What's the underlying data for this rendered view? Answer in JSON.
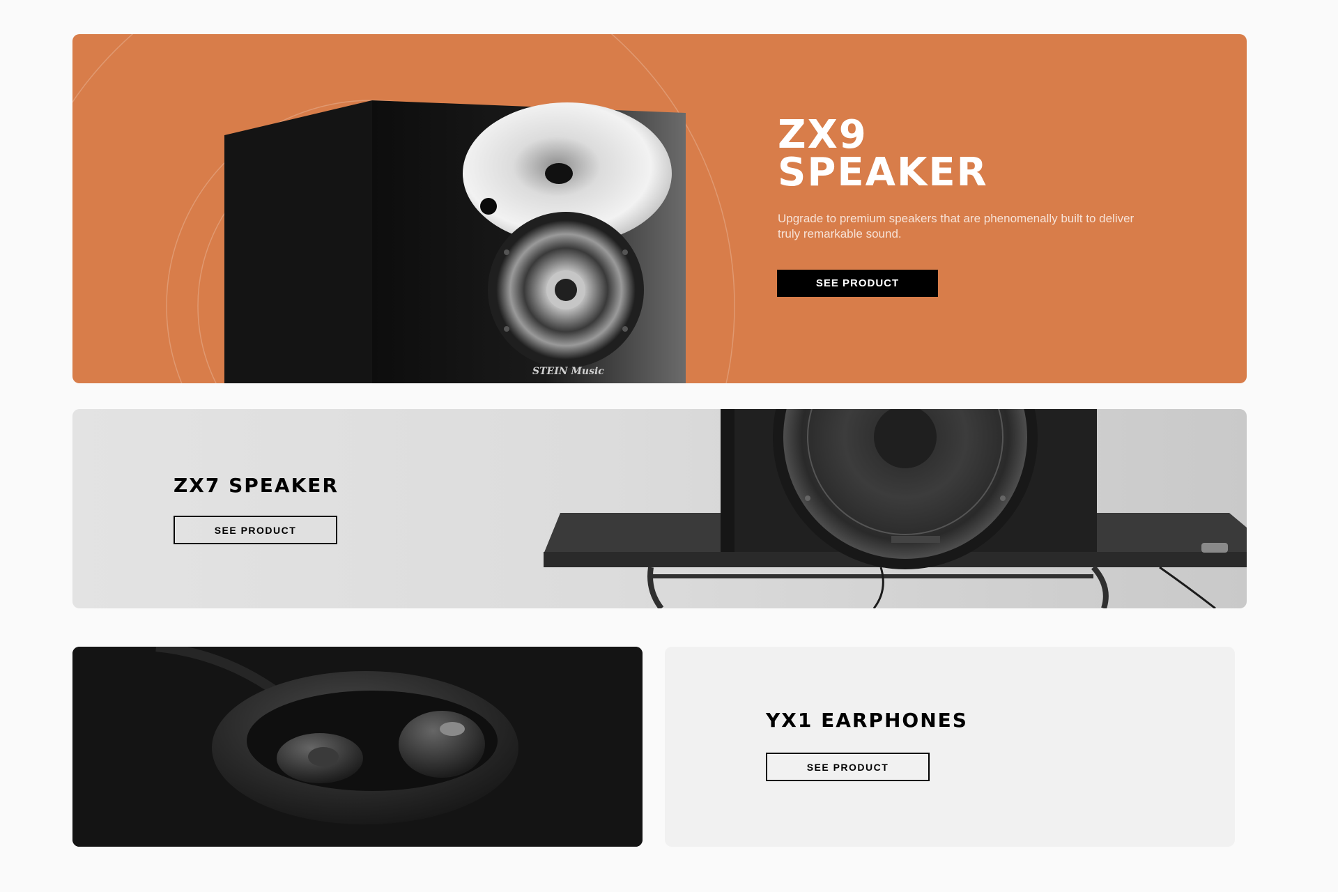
{
  "zx9": {
    "title_line1": "ZX9",
    "title_line2": "SPEAKER",
    "description": "Upgrade to premium speakers that are phenomenally built to deliver truly remarkable sound.",
    "button_label": "SEE PRODUCT",
    "speaker_brand": "STEIN Music",
    "accent_color": "#d87d4a"
  },
  "zx7": {
    "title": "ZX7 SPEAKER",
    "button_label": "SEE PRODUCT"
  },
  "yx1": {
    "title": "YX1 EARPHONES",
    "button_label": "SEE PRODUCT"
  }
}
